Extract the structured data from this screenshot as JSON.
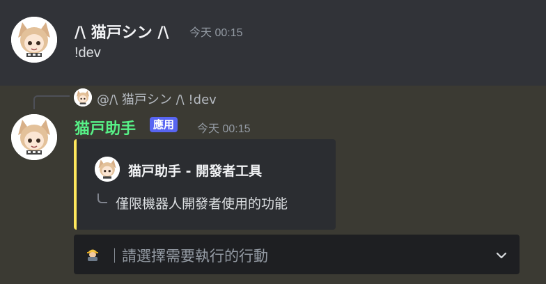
{
  "message1": {
    "username": "/\\ 猫戸シン /\\",
    "timestamp": "今天 00:15",
    "content": "!dev",
    "username_color": "#f2f3f5"
  },
  "reply": {
    "text": "@/\\ 猫戸シン /\\ !dev"
  },
  "message2": {
    "username": "猫戸助手",
    "username_color": "#57f287",
    "badge": "應用",
    "timestamp": "今天 00:15"
  },
  "embed": {
    "title": "猫戸助手 - 開發者工具",
    "description": "僅限機器人開發者使用的功能",
    "accent_color": "#fee75c"
  },
  "select_menu": {
    "icon": "construction-worker-icon",
    "placeholder": "｜請選擇需要執行的行動"
  }
}
